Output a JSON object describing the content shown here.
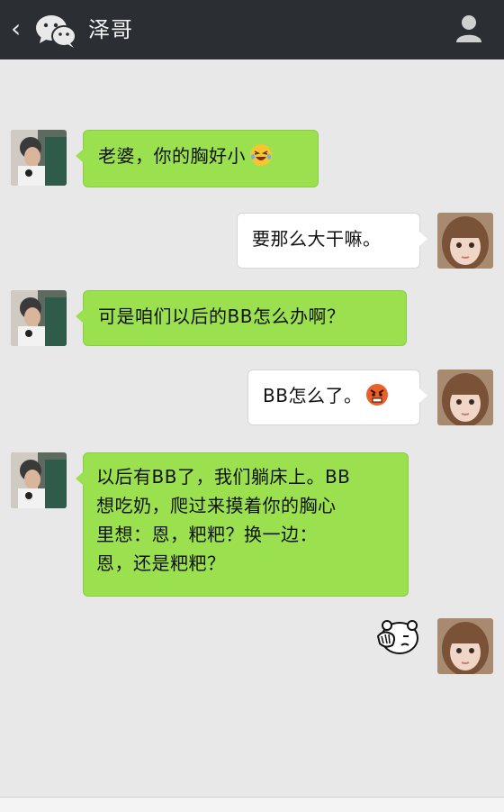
{
  "header": {
    "back_icon": "chevron-left-icon",
    "app_icon": "wechat-logo-icon",
    "contact_name": "泽哥",
    "profile_icon": "person-icon"
  },
  "messages": [
    {
      "side": "left",
      "sender": "boy",
      "text": "老婆，你的胸好小",
      "emoji": "laughing-tears-emoji"
    },
    {
      "side": "right",
      "sender": "girl",
      "text": "要那么大干嘛。"
    },
    {
      "side": "left",
      "sender": "boy",
      "text": "可是咱们以后的BB怎么办啊？"
    },
    {
      "side": "right",
      "sender": "girl",
      "text": "BB怎么了。",
      "emoji": "angry-face-emoji"
    },
    {
      "side": "left",
      "sender": "boy",
      "lines": [
        "以后有BB了，我们躺床上。BB",
        "想吃奶，爬过来摸着你的胸心",
        "里想：恩，粑粑？换一边：",
        "恩，还是粑粑？"
      ]
    },
    {
      "side": "right",
      "sender": "girl",
      "sticker": "facepalm-bear-sticker"
    }
  ],
  "colors": {
    "header_bg": "#2b2f33",
    "chat_bg": "#e8e8e8",
    "sent_bubble": "#9be04f",
    "received_bubble": "#ffffff"
  }
}
